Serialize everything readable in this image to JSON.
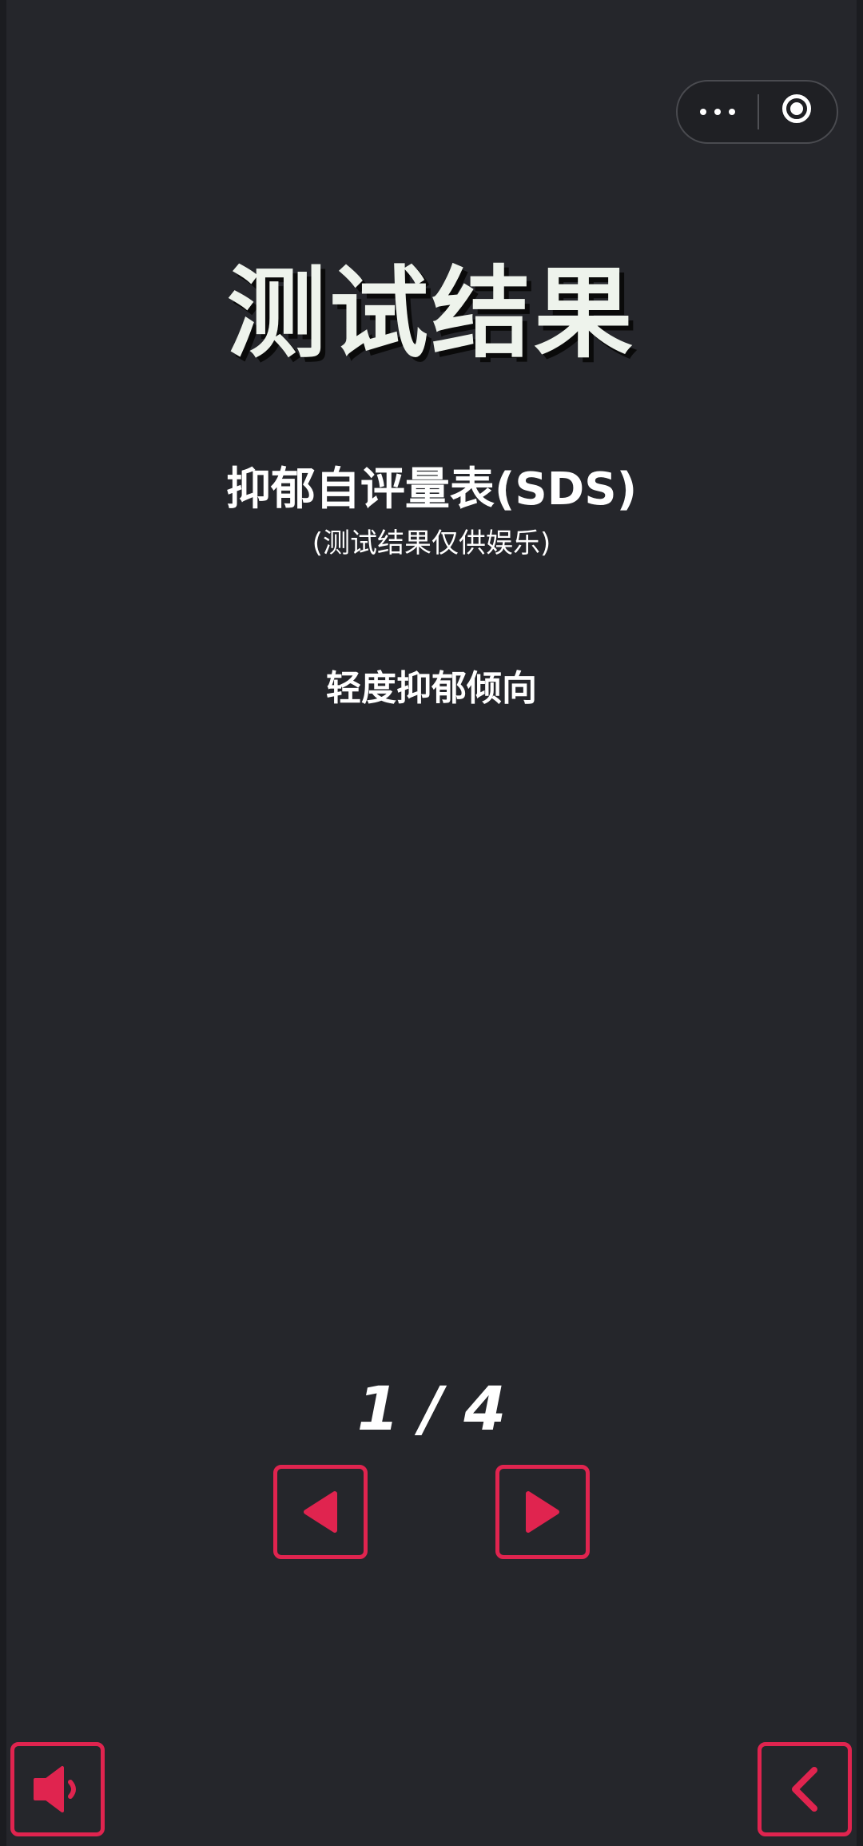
{
  "header": {
    "title": "测试结果"
  },
  "scale": {
    "name": "抑郁自评量表(SDS)",
    "note": "(测试结果仅供娱乐)"
  },
  "result": {
    "text": "轻度抑郁倾向"
  },
  "pager": {
    "text": "1 / 4",
    "current": 1,
    "total": 4
  },
  "icons": {
    "more": "more-dots-icon",
    "close": "target-close-icon",
    "prev": "triangle-left-icon",
    "next": "triangle-right-icon",
    "sound": "speaker-icon",
    "back": "chevron-left-icon"
  },
  "colors": {
    "background": "#25262b",
    "accent": "#e0244f",
    "title": "#eef3ec",
    "text": "#ffffff"
  }
}
